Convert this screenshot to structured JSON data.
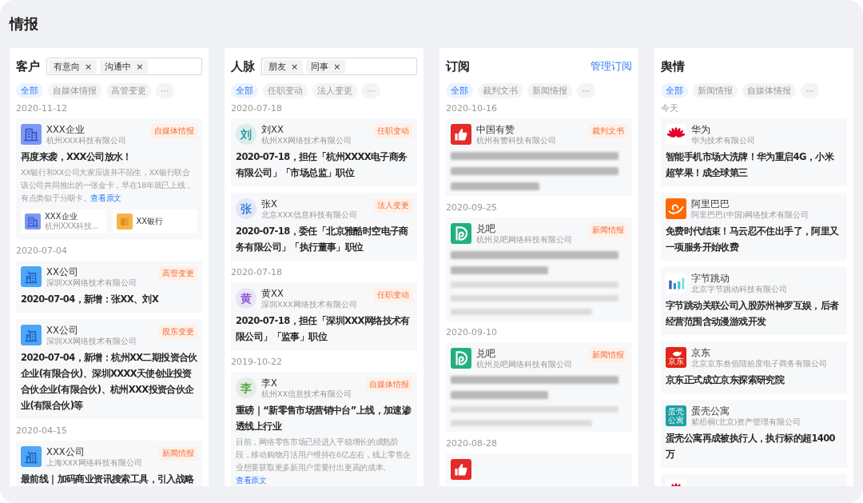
{
  "title": "情报",
  "columns": [
    {
      "title": "客户",
      "tags": [
        {
          "label": "有意向",
          "remove": "×"
        },
        {
          "label": "沟通中",
          "remove": "×"
        }
      ],
      "filters": [
        {
          "label": "全部",
          "selected": true
        },
        {
          "label": "自媒体情报",
          "selected": false
        },
        {
          "label": "高管变更",
          "selected": false
        },
        {
          "label": "···",
          "selected": false
        }
      ],
      "groups": [
        {
          "date": "2020-11-12",
          "cards": [
            {
              "avatar": {
                "kind": "building"
              },
              "name": "XXX企业",
              "company": "杭州XXX科技有限公司",
              "tag": "自媒体情报",
              "headline": "再度来袭，XXX公司放水！",
              "summary": "XX银行和XX公司大家应该并不陌生，XX银行联合该公司共同推出的一张金卡，早在18年就已上线，有点类似于分期卡。",
              "link": "查看原文",
              "related": [
                {
                  "avatar": {
                    "kind": "building"
                  },
                  "name": "XXX企业",
                  "company": "杭州XXX科技..."
                },
                {
                  "avatar": {
                    "kind": "coins"
                  },
                  "name": "XX银行"
                }
              ]
            }
          ]
        },
        {
          "date": "2020-07-04",
          "cards": [
            {
              "avatar": {
                "kind": "office"
              },
              "name": "XX公司",
              "company": "深圳XX网络技术有限公司",
              "tag": "高管变更",
              "headline": "2020-07-04，新增：张XX、刘X"
            },
            {
              "avatar": {
                "kind": "office"
              },
              "name": "XX公司",
              "company": "深圳XX网络技术有限公司",
              "tag": "股东变更",
              "headline": "2020-07-04，新增：杭州XX二期投资合伙企业(有限合伙)、深圳XXXX天使创业投资合伙企业(有限合伙)、杭州XXX投资合伙企业(有限合伙)等"
            }
          ]
        },
        {
          "date": "2020-04-15",
          "cards": [
            {
              "avatar": {
                "kind": "office"
              },
              "name": "XXX公司",
              "company": "上海XXX网络科技有限公司",
              "tag": "新闻情报",
              "headline": "最前线｜加码商业资讯搜索工具，引入战略"
            }
          ]
        }
      ]
    },
    {
      "title": "人脉",
      "tags": [
        {
          "label": "朋友",
          "remove": "×"
        },
        {
          "label": "同事",
          "remove": "×"
        }
      ],
      "filters": [
        {
          "label": "全部",
          "selected": true
        },
        {
          "label": "任职变动",
          "selected": false
        },
        {
          "label": "法人变更",
          "selected": false
        },
        {
          "label": "···",
          "selected": false
        }
      ],
      "groups": [
        {
          "date": "2020-07-18",
          "cards": [
            {
              "avatar": {
                "kind": "letter",
                "text": "刘",
                "color": "#2a9d98"
              },
              "name": "刘XX",
              "company": "杭州XX网络技术有限公司",
              "tag": "任职变动",
              "headline": "2020-07-18，担任「杭州XXXX电子商务有限公司」「市场总监」职位"
            },
            {
              "avatar": {
                "kind": "letter",
                "text": "张",
                "color": "#3b7be0"
              },
              "name": "张X",
              "company": "北京XXX信息科技有限公司",
              "tag": "法人变更",
              "headline": "2020-07-18，委任「北京雅酷时空电子商务有限公司」「执行董事」职位"
            }
          ]
        },
        {
          "date": "2020-07-18",
          "cards": [
            {
              "avatar": {
                "kind": "letter",
                "text": "黄",
                "color": "#8a5cd6"
              },
              "name": "黄XX",
              "company": "深圳XXX网络技术有限公司",
              "tag": "任职变动",
              "headline": "2020-07-18，担任「深圳XXX网络技术有限公司」「监事」职位"
            }
          ]
        },
        {
          "date": "2019-10-22",
          "cards": [
            {
              "avatar": {
                "kind": "letter",
                "text": "李",
                "color": "#5aa84a"
              },
              "name": "李X",
              "company": "杭州XX信息技术有限公司",
              "tag": "自媒体情报",
              "headline": "重磅｜“新零售市场营销中台”上线，加速渗透线上行业",
              "summary": "目前，网络零售市场已经进入平稳增长的成熟阶段，移动购物月活用户维持在6亿左右，线上零售企业想要获取更多新用户需要付出更高的成本。",
              "link": "查看原文"
            }
          ]
        }
      ]
    },
    {
      "title": "订阅",
      "action": "管理订阅",
      "filters": [
        {
          "label": "全部",
          "selected": true
        },
        {
          "label": "裁判文书",
          "selected": false
        },
        {
          "label": "新闻情报",
          "selected": false
        },
        {
          "label": "···",
          "selected": false
        }
      ],
      "groups": [
        {
          "date": "2020-10-16",
          "cards": [
            {
              "avatar": {
                "kind": "thumb"
              },
              "name": "中国有赞",
              "company": "杭州有赞科技有限公司",
              "tag": "裁判文书",
              "kind": "blurred_body"
            }
          ]
        },
        {
          "date": "2020-09-25",
          "cards": [
            {
              "avatar": {
                "kind": "d-mark"
              },
              "name": "兑吧",
              "company": "杭州兑吧网络科技有限公司",
              "tag": "新闻情报",
              "kind": "blurred_article"
            }
          ]
        },
        {
          "date": "2020-09-10",
          "cards": [
            {
              "avatar": {
                "kind": "d-mark"
              },
              "name": "兑吧",
              "company": "杭州兑吧网络科技有限公司",
              "tag": "新闻情报",
              "kind": "blurred_article_short"
            }
          ]
        },
        {
          "date": "2020-08-28",
          "cards": [
            {
              "avatar": {
                "kind": "thumb"
              }
            }
          ]
        }
      ]
    },
    {
      "title": "舆情",
      "filters": [
        {
          "label": "全部",
          "selected": true
        },
        {
          "label": "新闻情报",
          "selected": false
        },
        {
          "label": "自媒体情报",
          "selected": false
        },
        {
          "label": "···",
          "selected": false
        }
      ],
      "groups": [
        {
          "date": "今天",
          "cards": [
            {
              "avatar": {
                "kind": "petals"
              },
              "name": "华为",
              "company": "华为技术有限公司",
              "headline": "智能手机市场大洗牌！华为重启4G，小米超苹果！成全球第三"
            },
            {
              "avatar": {
                "kind": "swoosh"
              },
              "name": "阿里巴巴",
              "company": "阿里巴巴(中国)网络技术有限公司",
              "headline": "免费时代结束！马云忍不住出手了，阿里又一项服务开始收费"
            },
            {
              "avatar": {
                "kind": "bars"
              },
              "name": "字节跳动",
              "company": "北京字节跳动科技有限公司",
              "headline": "字节跳动关联公司入股苏州神罗互娱，后者经营范围含动漫游戏开发"
            },
            {
              "avatar": {
                "kind": "dog",
                "text": "京东"
              },
              "name": "京东",
              "company": "北京京东叁佰陆拾度电子商务有限公司",
              "headline": "京东正式成立京东探索研究院"
            },
            {
              "avatar": {
                "kind": "text-logo",
                "text": "蛋壳公寓"
              },
              "name": "蛋壳公寓",
              "company": "紫梧桐(北京)资产管理有限公司",
              "headline": "蛋壳公寓再成被执行人，执行标的超1400万"
            },
            {
              "avatar": {
                "kind": "petals"
              }
            }
          ]
        }
      ]
    }
  ]
}
